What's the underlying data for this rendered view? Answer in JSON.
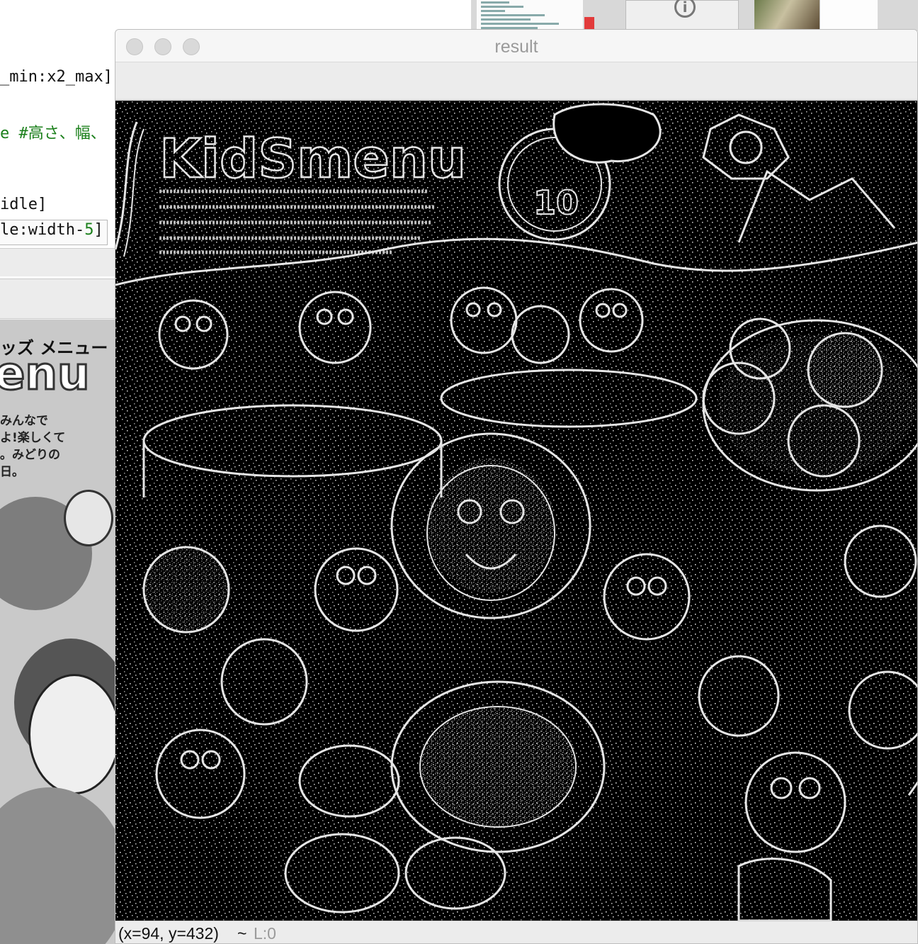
{
  "editor": {
    "lines": [
      "_min:x2_max]",
      "e #高さ、幅、",
      "idle]",
      "le:width-",
      "5",
      "]"
    ]
  },
  "preview": {
    "kana": "ッズ メニュー",
    "title_fragment": "enu",
    "text_lines": [
      "みんなで",
      "よ!楽しくて",
      "。みどりの",
      "日。"
    ]
  },
  "window": {
    "title": "result"
  },
  "image": {
    "title_text": "KidSmenu",
    "badge_number": "10"
  },
  "status": {
    "coords": "(x=94, y=432)",
    "separator": "~",
    "level": "L:0"
  },
  "colors": {
    "canvas_background": "#000000",
    "edge_lines": "#e8e8e8",
    "comment": "#1a7f1a"
  }
}
